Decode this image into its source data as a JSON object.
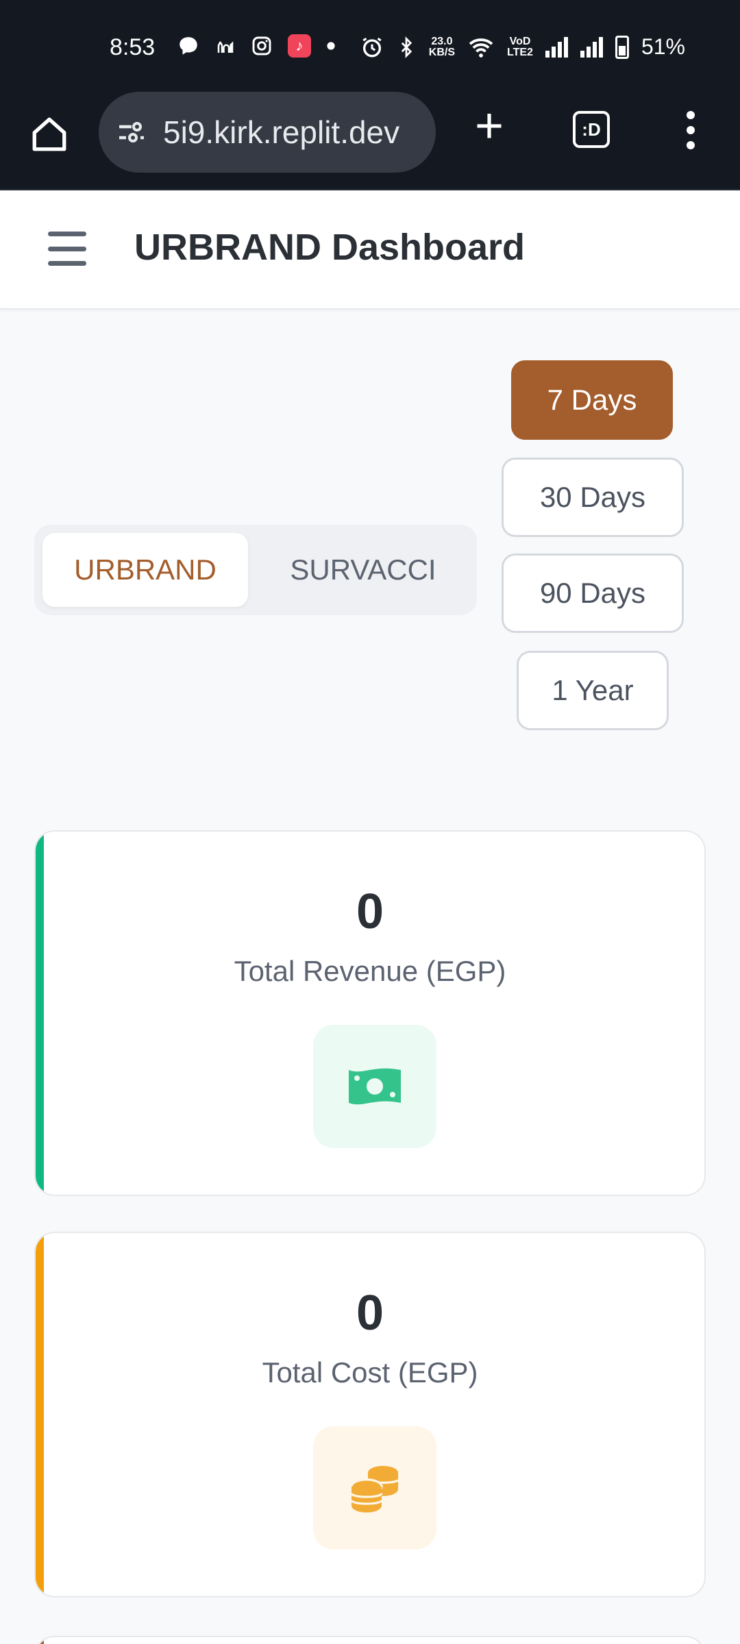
{
  "status_bar": {
    "time": "8:53",
    "network_speed_value": "23.0",
    "network_speed_unit": "KB/S",
    "carrier_label_top": "VoD",
    "carrier_label_bottom": "LTE2",
    "battery_percent": "51%"
  },
  "browser": {
    "url": "5i9.kirk.replit.dev",
    "tabs_label": ":D"
  },
  "header": {
    "title": "URBRAND Dashboard"
  },
  "period_filter": {
    "options": [
      "7 Days",
      "30 Days",
      "90 Days",
      "1 Year"
    ],
    "selected": "7 Days"
  },
  "brand_toggle": {
    "options": [
      "URBRAND",
      "SURVACCI"
    ],
    "selected": "URBRAND"
  },
  "stats": [
    {
      "value": "0",
      "label": "Total Revenue (EGP)",
      "icon": "money-bill-icon",
      "accent": "#10b981",
      "icon_bg": "#ecfaf4",
      "icon_color": "#34c48b"
    },
    {
      "value": "0",
      "label": "Total Cost (EGP)",
      "icon": "coins-icon",
      "accent": "#f59e0b",
      "icon_bg": "#fef6e8",
      "icon_color": "#f2ac35"
    }
  ],
  "colors": {
    "brand": "#a45d2c",
    "next_card_accent": "#a45d2c"
  }
}
